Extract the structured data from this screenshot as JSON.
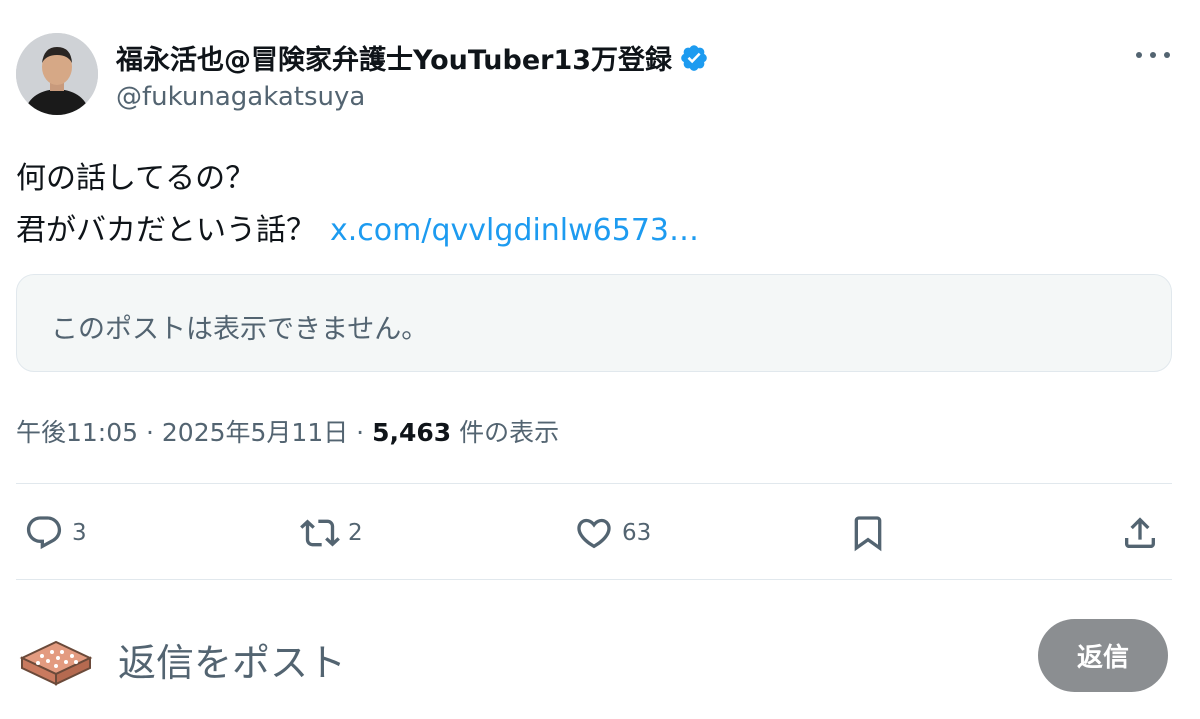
{
  "author": {
    "display_name": "福永活也@冒険家弁護士YouTuber13万登録",
    "handle": "@fukunagakatsuya",
    "verified_color": "#1d9bf0"
  },
  "post": {
    "line1": "何の話してるの？",
    "line2": "君がバカだという話？",
    "link": "x.com/qvvlgdinlw6573…"
  },
  "quoted": {
    "unavailable_text": "このポストは表示できません。"
  },
  "meta": {
    "time": "午後11:05",
    "separator": " · ",
    "date": "2025年5月11日",
    "views": "5,463",
    "views_label": " 件の表示"
  },
  "actions": {
    "reply_count": "3",
    "retweet_count": "2",
    "like_count": "63"
  },
  "composer": {
    "placeholder": "返信をポスト",
    "button_label": "返信"
  },
  "icons": {
    "more": "more-icon",
    "reply": "reply-icon",
    "retweet": "retweet-icon",
    "like": "heart-icon",
    "bookmark": "bookmark-icon",
    "share": "share-icon",
    "verified": "verified-badge-icon"
  }
}
